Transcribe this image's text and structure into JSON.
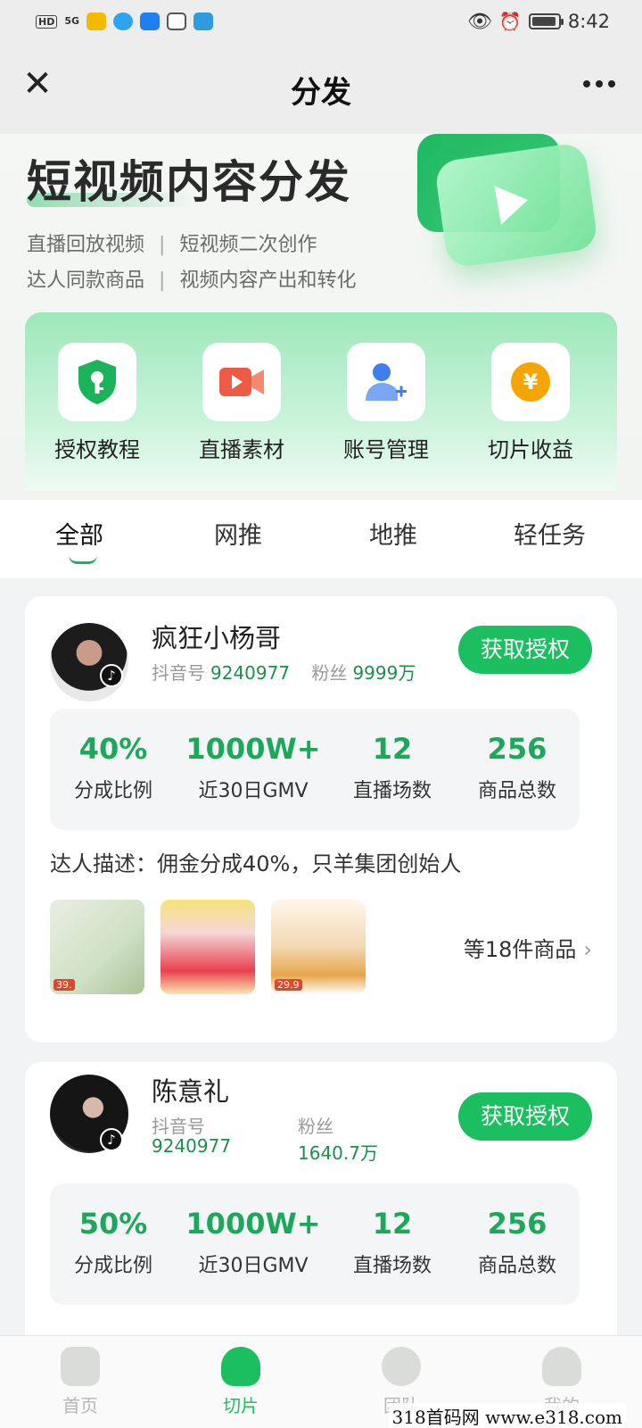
{
  "status_bar": {
    "time": "8:42",
    "left_badges": [
      "HD",
      "5G"
    ]
  },
  "navbar": {
    "title": "分发",
    "close_icon": "close-icon",
    "more_icon": "more-icon"
  },
  "hero": {
    "title": "短视频内容分发",
    "line1": [
      "直播回放视频",
      "短视频二次创作"
    ],
    "line2": [
      "达人同款商品",
      "视频内容产出和转化"
    ],
    "separator": "|"
  },
  "features": [
    {
      "label": "授权教程",
      "icon": "shield-key-icon",
      "color": "#1bb35a"
    },
    {
      "label": "直播素材",
      "icon": "video-camera-icon",
      "color": "#ee5b45"
    },
    {
      "label": "账号管理",
      "icon": "add-user-icon",
      "color": "#3f7ef0"
    },
    {
      "label": "切片收益",
      "icon": "yuan-coin-icon",
      "color": "#f6a500"
    }
  ],
  "tabs": [
    {
      "label": "全部",
      "active": true
    },
    {
      "label": "网推",
      "active": false
    },
    {
      "label": "地推",
      "active": false
    },
    {
      "label": "轻任务",
      "active": false
    }
  ],
  "cards": [
    {
      "name": "疯狂小杨哥",
      "douyin_label": "抖音号",
      "douyin_id": "9240977",
      "fans_label": "粉丝",
      "fans": "9999万",
      "button": "获取授权",
      "stats": [
        {
          "value": "40%",
          "label": "分成比例"
        },
        {
          "value": "1000W+",
          "label": "近30日GMV"
        },
        {
          "value": "12",
          "label": "直播场数"
        },
        {
          "value": "256",
          "label": "商品总数"
        }
      ],
      "desc_label": "达人描述：",
      "desc": "佣金分成40%，只羊集团创始人",
      "product_tags": [
        "39.",
        "",
        "29.9"
      ],
      "more_products": "等18件商品"
    },
    {
      "name": "陈意礼",
      "douyin_label": "抖音号",
      "douyin_id": "9240977",
      "fans_label": "粉丝",
      "fans": "1640.7万",
      "button": "获取授权",
      "stats": [
        {
          "value": "50%",
          "label": "分成比例"
        },
        {
          "value": "1000W+",
          "label": "近30日GMV"
        },
        {
          "value": "12",
          "label": "直播场数"
        },
        {
          "value": "256",
          "label": "商品总数"
        }
      ]
    }
  ],
  "bottom_nav": [
    {
      "label": "首页",
      "icon": "home-icon",
      "active": false
    },
    {
      "label": "切片",
      "icon": "slice-icon",
      "active": true
    },
    {
      "label": "团队",
      "icon": "team-icon",
      "active": false
    },
    {
      "label": "我的",
      "icon": "profile-icon",
      "active": false
    }
  ],
  "watermark": "318首码网 www.e318.com",
  "colors": {
    "accent": "#1bbf60",
    "stat_value": "#1ba85a",
    "meta_value": "#1f8d4e"
  }
}
